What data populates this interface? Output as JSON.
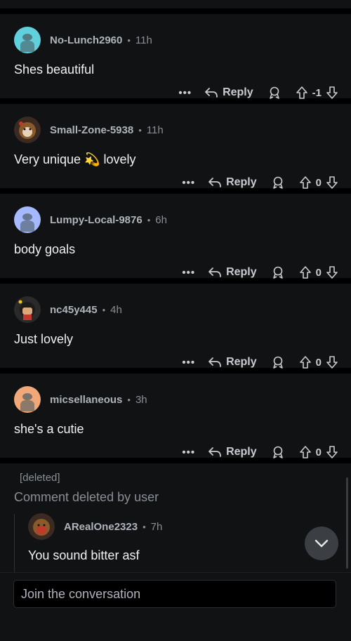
{
  "comments": [
    {
      "username": "No-Lunch2960",
      "age": "11h",
      "text": "Shes beautiful",
      "score": "-1",
      "avatar_color": "#5fd0dc"
    },
    {
      "username": "Small-Zone-5938",
      "age": "11h",
      "text": "Very unique 💫 lovely",
      "score": "0",
      "avatar_color": "#3a2a22"
    },
    {
      "username": "Lumpy-Local-9876",
      "age": "6h",
      "text": "body goals",
      "score": "0",
      "avatar_color": "#a6b8ff"
    },
    {
      "username": "nc45y445",
      "age": "4h",
      "text": "Just lovely",
      "score": "0",
      "avatar_color": "#2a2a2a"
    },
    {
      "username": "micsellaneous",
      "age": "3h",
      "text": "she's a cutie",
      "score": "0",
      "avatar_color": "#f0a878"
    }
  ],
  "actions": {
    "more": "•••",
    "reply": "Reply"
  },
  "deleted": {
    "tag": "[deleted]",
    "message": "Comment deleted by user",
    "reply": {
      "username": "ARealOne2323",
      "age": "7h",
      "text": "You sound bitter asf",
      "avatar_color": "#3a2a22"
    }
  },
  "composer": {
    "placeholder": "Join the conversation"
  },
  "icons": [
    "reply-arrow-icon",
    "award-icon",
    "upvote-icon",
    "downvote-icon",
    "chevron-down-icon",
    "more-dots-icon"
  ]
}
